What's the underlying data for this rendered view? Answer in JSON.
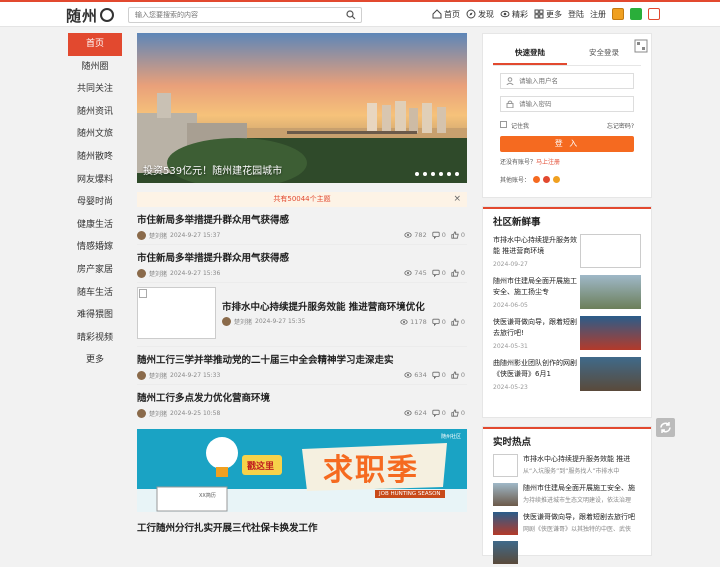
{
  "header": {
    "logo_text": "随州",
    "search_placeholder": "输入您要搜索的内容",
    "nav": [
      {
        "label": "首页",
        "icon": "home-icon"
      },
      {
        "label": "发现",
        "icon": "compass-icon"
      },
      {
        "label": "精彩",
        "icon": "eye-icon"
      },
      {
        "label": "更多",
        "icon": "grid-icon"
      }
    ],
    "login": "登陆",
    "register": "注册"
  },
  "sidebar": {
    "items": [
      "首页",
      "随州圈",
      "共同关注",
      "随州资讯",
      "随州文旅",
      "随州散咚",
      "网友爆料",
      "母婴时尚",
      "健康生活",
      "情感婚嫁",
      "房产家居",
      "随车生活",
      "难得猥图",
      "晴彩视频",
      "更多"
    ]
  },
  "banner": {
    "caption": "投资539亿元！随州建花园城市",
    "dot_count": 6
  },
  "notice": {
    "text": "共有50044个主题"
  },
  "posts": [
    {
      "title": "市住新局多举措提升群众用气获得感",
      "author": "楚刘猪",
      "date": "2024-9-27 15:37",
      "views": "782",
      "comments": "0",
      "likes": "0"
    },
    {
      "title": "市住新局多举措提升群众用气获得感",
      "author": "楚刘猪",
      "date": "2024-9-27 15:36",
      "views": "745",
      "comments": "0",
      "likes": "0"
    },
    {
      "title": "市排水中心持续提升服务效能 推进营商环境优化",
      "author": "楚刘猪",
      "date": "2024-9-27 15:35",
      "views": "1178",
      "comments": "0",
      "likes": "0"
    },
    {
      "title": "随州工行三学并举推动党的二十届三中全会精神学习走深走实",
      "author": "楚刘猪",
      "date": "2024-9-27 15:33",
      "views": "634",
      "comments": "0",
      "likes": "0"
    },
    {
      "title": "随州工行多点发力优化营商环境",
      "author": "楚刘猪",
      "date": "2024-9-25 10:58",
      "views": "624",
      "comments": "0",
      "likes": "0"
    },
    {
      "title": "工行随州分行扎实开展三代社保卡换发工作",
      "author": "",
      "date": "",
      "views": "",
      "comments": "",
      "likes": ""
    }
  ],
  "ad": {
    "left_text": "戳这里",
    "big_text": "求职季",
    "sub_text": "JOB HUNTING SEASON",
    "brand": "随州社区",
    "paper_label": "XX简历"
  },
  "login_box": {
    "tab_quick": "快速登陆",
    "tab_secure": "安全登录",
    "user_placeholder": "请输入用户名",
    "pass_placeholder": "请输入密码",
    "remember": "记住我",
    "forgot": "忘记密码?",
    "button": "登 入",
    "no_account": "还没有账号？",
    "register_link": "马上注册",
    "other_accounts": "其他账号："
  },
  "community": {
    "heading": "社区新鲜事",
    "items": [
      {
        "title": "市排水中心持续提升服务效能 推进营商环境",
        "date": "2024-09-27"
      },
      {
        "title": "随州市住建局全面开展施工安全、施工扬尘专",
        "date": "2024-06-05"
      },
      {
        "title": "侠医谦哥做向导，跟着短剧去旅行吧!",
        "date": "2024-05-31"
      },
      {
        "title": "曲随州影业团队创作的网剧《侠医谦哥》6月1",
        "date": "2024-05-23"
      }
    ]
  },
  "hot": {
    "heading": "实时热点",
    "items": [
      {
        "title": "市排水中心持续提升服务效能 推进",
        "summary": "从“入坑服务”到“服务找人”市排水中"
      },
      {
        "title": "随州市住建局全面开展施工安全、施",
        "summary": "为持续推进城市生态文明建设，依法治理"
      },
      {
        "title": "侠医谦哥做向导，跟着短剧去旅行吧",
        "summary": "网剧《侠医谦哥》以其独特的中医、武侠"
      },
      {
        "title": "",
        "summary": ""
      }
    ]
  },
  "colors": {
    "accent": "#e2492f",
    "login_button": "#f56a20",
    "notice_bg": "#fdf3e6"
  }
}
